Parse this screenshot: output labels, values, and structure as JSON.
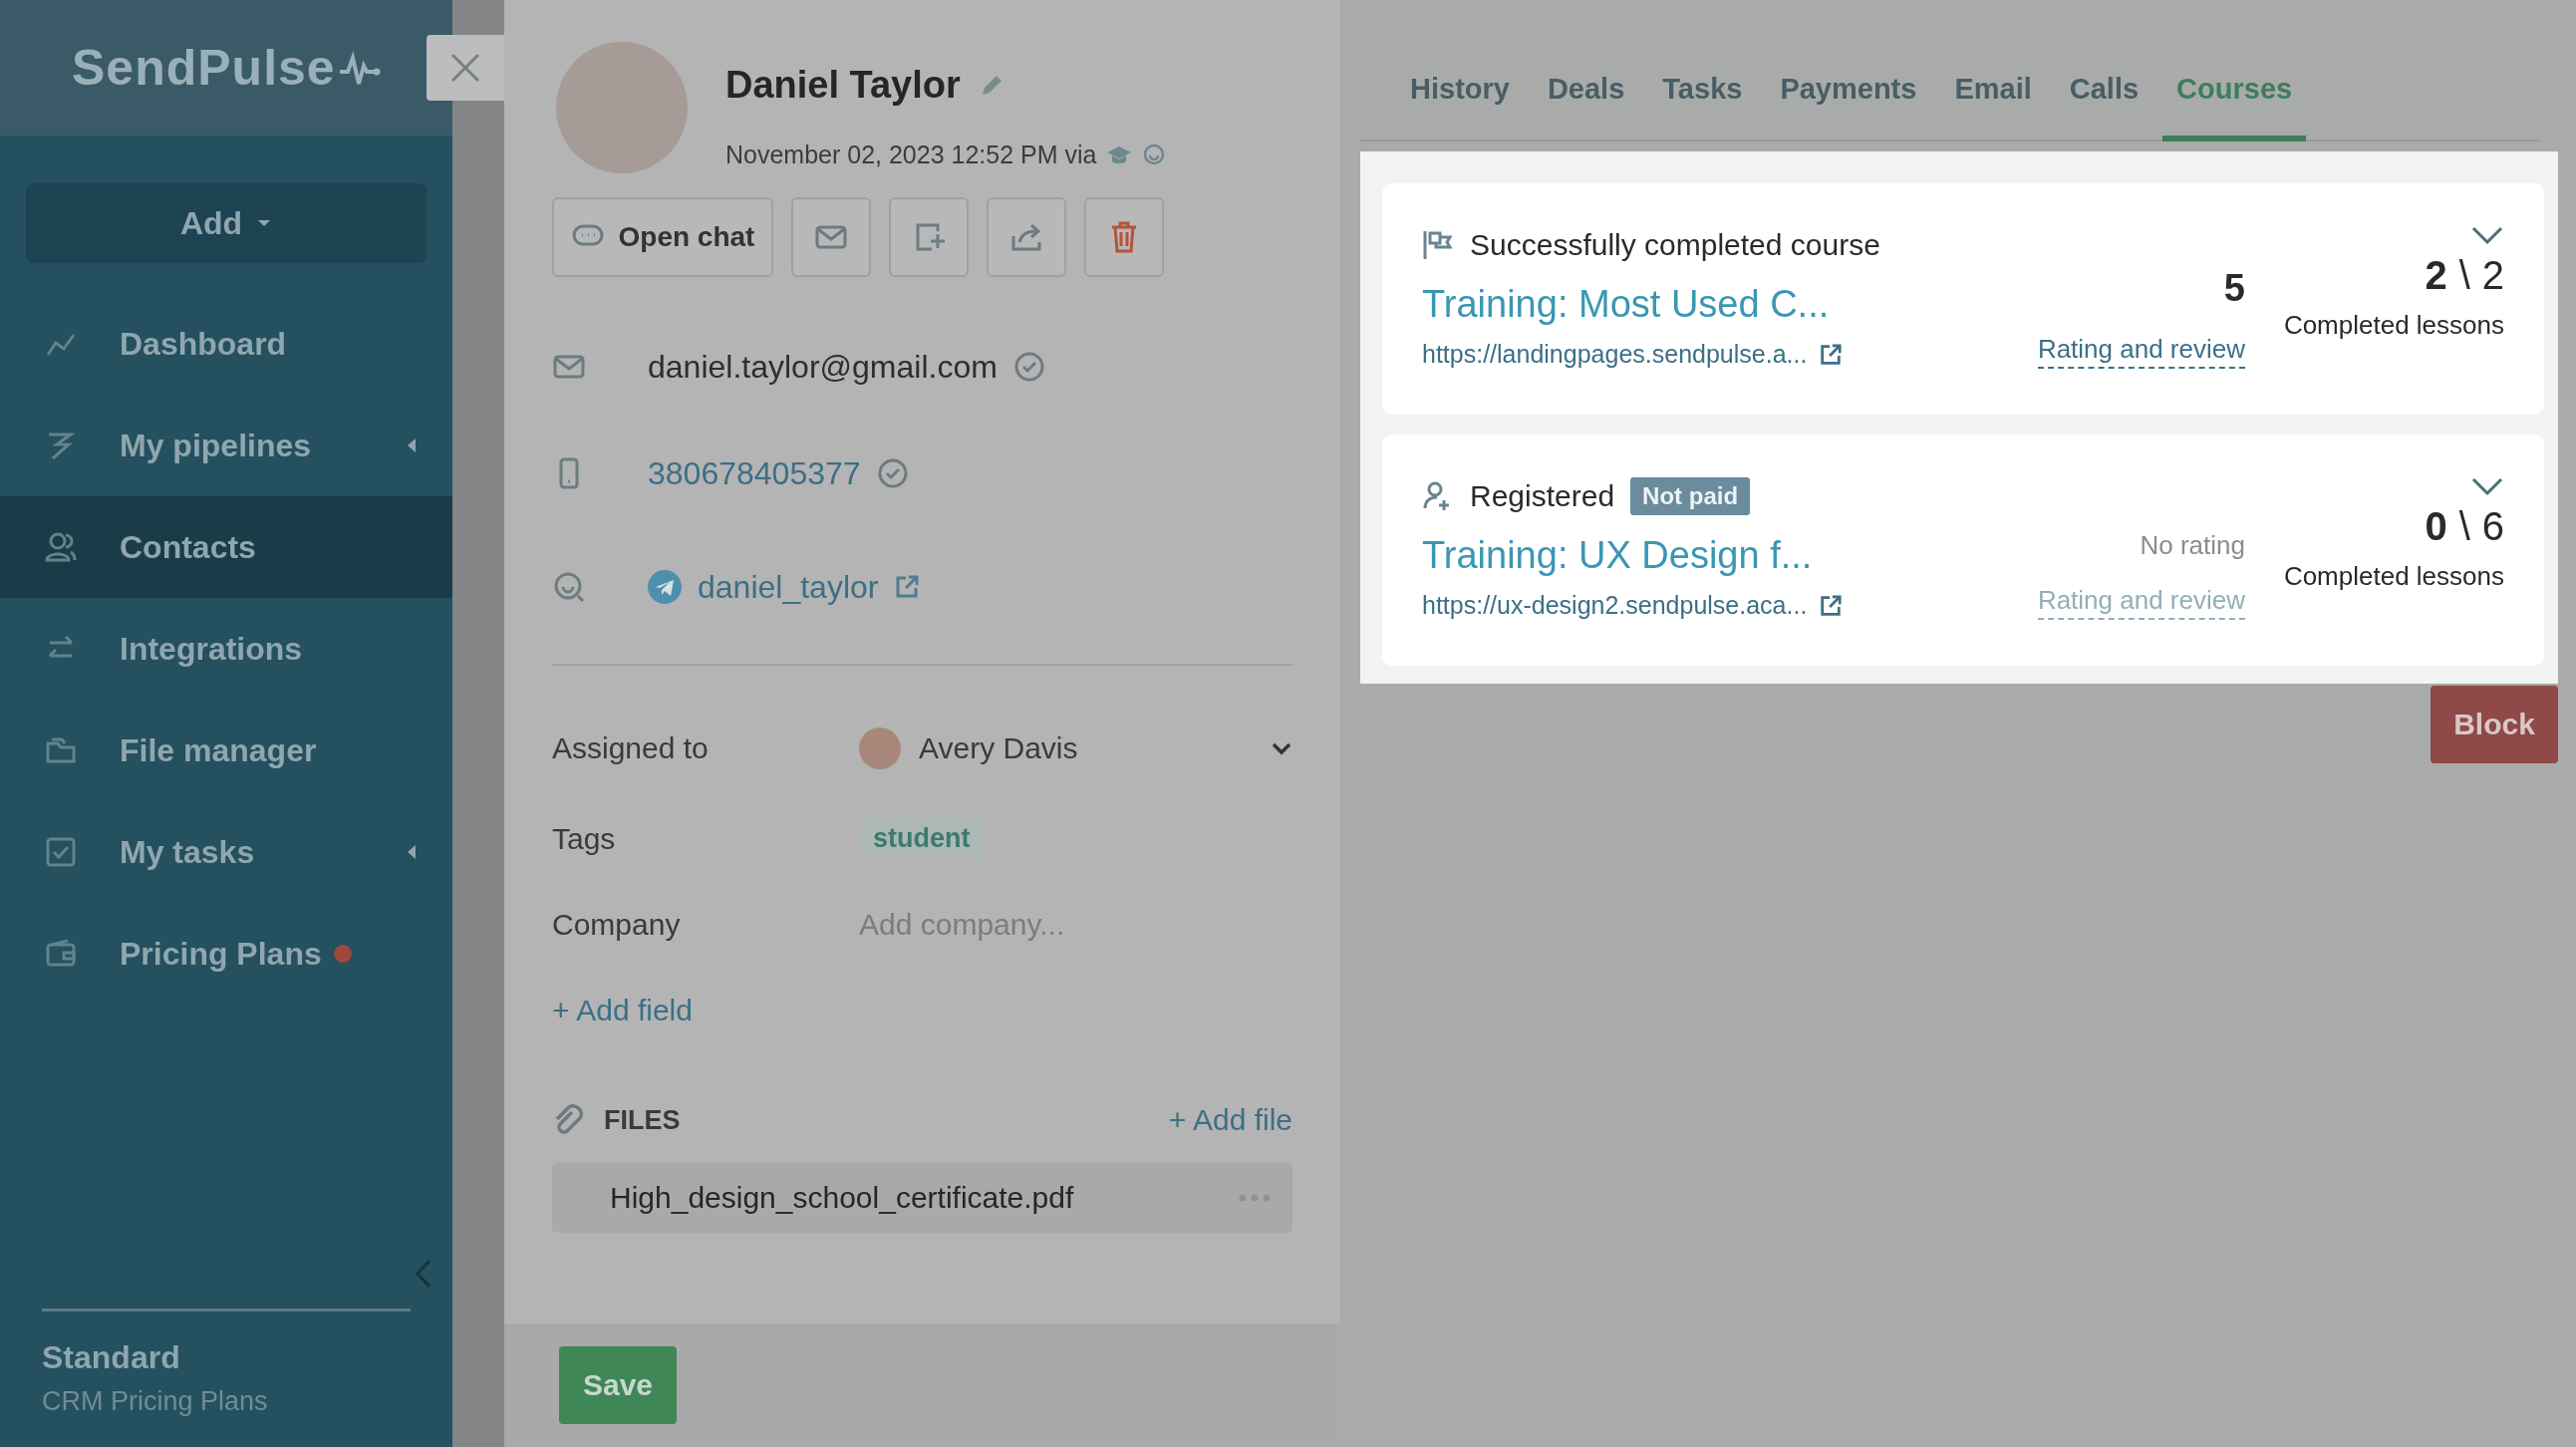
{
  "sidebar": {
    "logo": "SendPulse",
    "add_button": "Add",
    "items": [
      {
        "label": "Dashboard",
        "selected": false,
        "expandable": false,
        "alert": false
      },
      {
        "label": "My pipelines",
        "selected": false,
        "expandable": true,
        "alert": false
      },
      {
        "label": "Contacts",
        "selected": true,
        "expandable": false,
        "alert": false
      },
      {
        "label": "Integrations",
        "selected": false,
        "expandable": false,
        "alert": false
      },
      {
        "label": "File manager",
        "selected": false,
        "expandable": false,
        "alert": false
      },
      {
        "label": "My tasks",
        "selected": false,
        "expandable": true,
        "alert": false
      },
      {
        "label": "Pricing Plans",
        "selected": false,
        "expandable": false,
        "alert": true
      }
    ],
    "plan": {
      "name": "Standard",
      "subtitle": "CRM Pricing Plans"
    }
  },
  "contact": {
    "name": "Daniel Taylor",
    "created": "November 02, 2023 12:52 PM via",
    "open_chat": "Open chat",
    "actions": [
      {
        "kind": "email"
      },
      {
        "kind": "add"
      },
      {
        "kind": "share"
      },
      {
        "kind": "delete"
      }
    ],
    "channels": [
      {
        "kind": "email",
        "value": "daniel.taylor@gmail.com",
        "verified": true
      },
      {
        "kind": "phone",
        "value": "380678405377",
        "verified": true
      },
      {
        "kind": "telegram",
        "value": "daniel_taylor",
        "verified": false
      }
    ],
    "assigned": {
      "label": "Assigned to",
      "value": "Avery Davis"
    },
    "tags": {
      "label": "Tags",
      "items": [
        "student"
      ]
    },
    "company": {
      "label": "Company",
      "placeholder": "Add company..."
    },
    "add_field": "+ Add field",
    "files": {
      "title": "FILES",
      "add": "+ Add file",
      "items": [
        "High_design_school_certificate.pdf"
      ]
    },
    "save": "Save"
  },
  "tabs": [
    {
      "label": "History",
      "selected": false
    },
    {
      "label": "Deals",
      "selected": false
    },
    {
      "label": "Tasks",
      "selected": false
    },
    {
      "label": "Payments",
      "selected": false
    },
    {
      "label": "Email",
      "selected": false
    },
    {
      "label": "Calls",
      "selected": false
    },
    {
      "label": "Courses",
      "selected": true
    }
  ],
  "courses": [
    {
      "kind": "completed",
      "status": "Successfully completed course",
      "title": "Training: Most Used C...",
      "url": "https://landingpages.sendpulse.a...",
      "rated": true,
      "rating": "5",
      "rating_link": "Rating and review",
      "done": "2",
      "separator": "\\",
      "total": "2",
      "progress_label": "Completed lessons"
    },
    {
      "kind": "registered",
      "status": "Registered",
      "badge": "Not paid",
      "title": "Training: UX Design f...",
      "url": "https://ux-design2.sendpulse.aca...",
      "rated": false,
      "rating": "No rating",
      "rating_link": "Rating and review",
      "done": "0",
      "separator": "\\",
      "total": "6",
      "progress_label": "Completed lessons"
    }
  ],
  "block_button": "Block"
}
